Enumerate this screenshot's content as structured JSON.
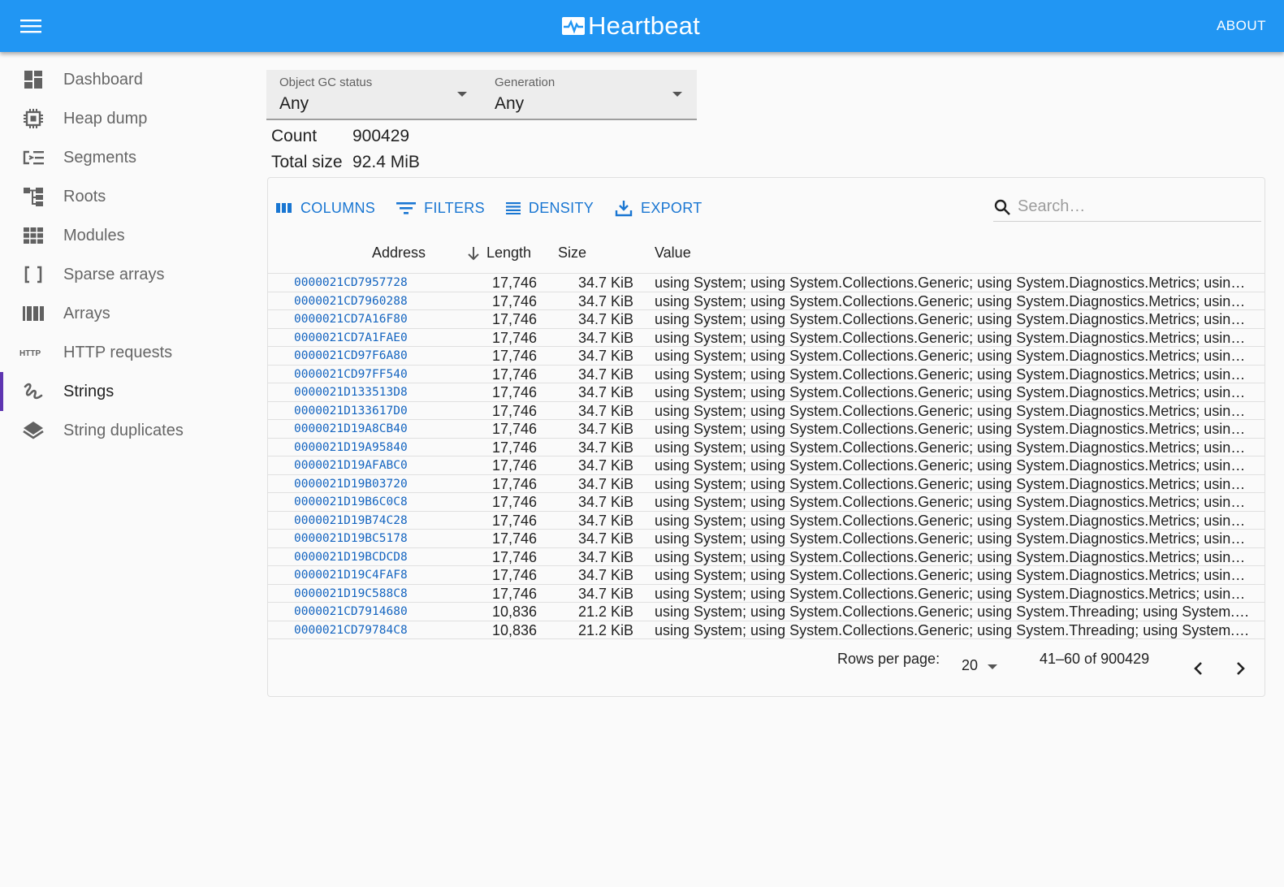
{
  "appbar": {
    "title": "Heartbeat",
    "about_label": "ABOUT"
  },
  "sidebar": {
    "items": [
      {
        "label": "Dashboard",
        "icon": "dashboard-icon"
      },
      {
        "label": "Heap dump",
        "icon": "memory-chip-icon"
      },
      {
        "label": "Segments",
        "icon": "segments-icon"
      },
      {
        "label": "Roots",
        "icon": "roots-tree-icon"
      },
      {
        "label": "Modules",
        "icon": "modules-grid-icon"
      },
      {
        "label": "Sparse arrays",
        "icon": "brackets-icon"
      },
      {
        "label": "Arrays",
        "icon": "arrays-icon"
      },
      {
        "label": "HTTP requests",
        "icon": "http-icon"
      },
      {
        "label": "Strings",
        "icon": "strings-icon",
        "active": true
      },
      {
        "label": "String duplicates",
        "icon": "layers-icon"
      }
    ]
  },
  "filters": {
    "gc_status": {
      "label": "Object GC status",
      "value": "Any"
    },
    "generation": {
      "label": "Generation",
      "value": "Any"
    }
  },
  "stats": {
    "count_label": "Count",
    "count_value": "900429",
    "size_label": "Total size",
    "size_value": "92.4 MiB"
  },
  "toolbar": {
    "columns": "COLUMNS",
    "filters": "FILTERS",
    "density": "DENSITY",
    "export": "EXPORT",
    "search_placeholder": "Search…"
  },
  "table": {
    "headers": {
      "address": "Address",
      "length": "Length",
      "size": "Size",
      "value": "Value"
    },
    "rows": [
      {
        "address": "0000021CD7957728",
        "length": "17,746",
        "size": "34.7 KiB",
        "value": "using System; using System.Collections.Generic; using System.Diagnostics.Metrics; using System.Threading; using System.Threading.Tasks;"
      },
      {
        "address": "0000021CD7960288",
        "length": "17,746",
        "size": "34.7 KiB",
        "value": "using System; using System.Collections.Generic; using System.Diagnostics.Metrics; using System.Threading; using System.Threading.Tasks;"
      },
      {
        "address": "0000021CD7A16F80",
        "length": "17,746",
        "size": "34.7 KiB",
        "value": "using System; using System.Collections.Generic; using System.Diagnostics.Metrics; using System.Threading; using System.Threading.Tasks;"
      },
      {
        "address": "0000021CD7A1FAE0",
        "length": "17,746",
        "size": "34.7 KiB",
        "value": "using System; using System.Collections.Generic; using System.Diagnostics.Metrics; using System.Threading; using System.Threading.Tasks;"
      },
      {
        "address": "0000021CD97F6A80",
        "length": "17,746",
        "size": "34.7 KiB",
        "value": "using System; using System.Collections.Generic; using System.Diagnostics.Metrics; using System.Threading; using System.Threading.Tasks;"
      },
      {
        "address": "0000021CD97FF540",
        "length": "17,746",
        "size": "34.7 KiB",
        "value": "using System; using System.Collections.Generic; using System.Diagnostics.Metrics; using System.Threading; using System.Threading.Tasks;"
      },
      {
        "address": "0000021D133513D8",
        "length": "17,746",
        "size": "34.7 KiB",
        "value": "using System; using System.Collections.Generic; using System.Diagnostics.Metrics; using System.Threading; using System.Threading.Tasks;"
      },
      {
        "address": "0000021D133617D0",
        "length": "17,746",
        "size": "34.7 KiB",
        "value": "using System; using System.Collections.Generic; using System.Diagnostics.Metrics; using System.Threading; using System.Threading.Tasks;"
      },
      {
        "address": "0000021D19A8CB40",
        "length": "17,746",
        "size": "34.7 KiB",
        "value": "using System; using System.Collections.Generic; using System.Diagnostics.Metrics; using System.Threading; using System.Threading.Tasks;"
      },
      {
        "address": "0000021D19A95840",
        "length": "17,746",
        "size": "34.7 KiB",
        "value": "using System; using System.Collections.Generic; using System.Diagnostics.Metrics; using System.Threading; using System.Threading.Tasks;"
      },
      {
        "address": "0000021D19AFABC0",
        "length": "17,746",
        "size": "34.7 KiB",
        "value": "using System; using System.Collections.Generic; using System.Diagnostics.Metrics; using System.Threading; using System.Threading.Tasks;"
      },
      {
        "address": "0000021D19B03720",
        "length": "17,746",
        "size": "34.7 KiB",
        "value": "using System; using System.Collections.Generic; using System.Diagnostics.Metrics; using System.Threading; using System.Threading.Tasks;"
      },
      {
        "address": "0000021D19B6C0C8",
        "length": "17,746",
        "size": "34.7 KiB",
        "value": "using System; using System.Collections.Generic; using System.Diagnostics.Metrics; using System.Threading; using System.Threading.Tasks;"
      },
      {
        "address": "0000021D19B74C28",
        "length": "17,746",
        "size": "34.7 KiB",
        "value": "using System; using System.Collections.Generic; using System.Diagnostics.Metrics; using System.Threading; using System.Threading.Tasks;"
      },
      {
        "address": "0000021D19BC5178",
        "length": "17,746",
        "size": "34.7 KiB",
        "value": "using System; using System.Collections.Generic; using System.Diagnostics.Metrics; using System.Threading; using System.Threading.Tasks;"
      },
      {
        "address": "0000021D19BCDCD8",
        "length": "17,746",
        "size": "34.7 KiB",
        "value": "using System; using System.Collections.Generic; using System.Diagnostics.Metrics; using System.Threading; using System.Threading.Tasks;"
      },
      {
        "address": "0000021D19C4FAF8",
        "length": "17,746",
        "size": "34.7 KiB",
        "value": "using System; using System.Collections.Generic; using System.Diagnostics.Metrics; using System.Threading; using System.Threading.Tasks;"
      },
      {
        "address": "0000021D19C588C8",
        "length": "17,746",
        "size": "34.7 KiB",
        "value": "using System; using System.Collections.Generic; using System.Diagnostics.Metrics; using System.Threading; using System.Threading.Tasks;"
      },
      {
        "address": "0000021CD7914680",
        "length": "10,836",
        "size": "21.2 KiB",
        "value": "using System; using System.Collections.Generic; using System.Threading; using System.Threading.Tasks; using System.Linq;"
      },
      {
        "address": "0000021CD79784C8",
        "length": "10,836",
        "size": "21.2 KiB",
        "value": "using System; using System.Collections.Generic; using System.Threading; using System.Threading.Tasks; using System.Linq;"
      }
    ]
  },
  "pagination": {
    "rows_per_page_label": "Rows per page:",
    "rows_per_page": "20",
    "range": "41–60 of 900429"
  },
  "colors": {
    "appbar": "#2196f3",
    "link": "#1565c0",
    "button": "#1976d2",
    "active_indicator": "#5e35b1"
  }
}
